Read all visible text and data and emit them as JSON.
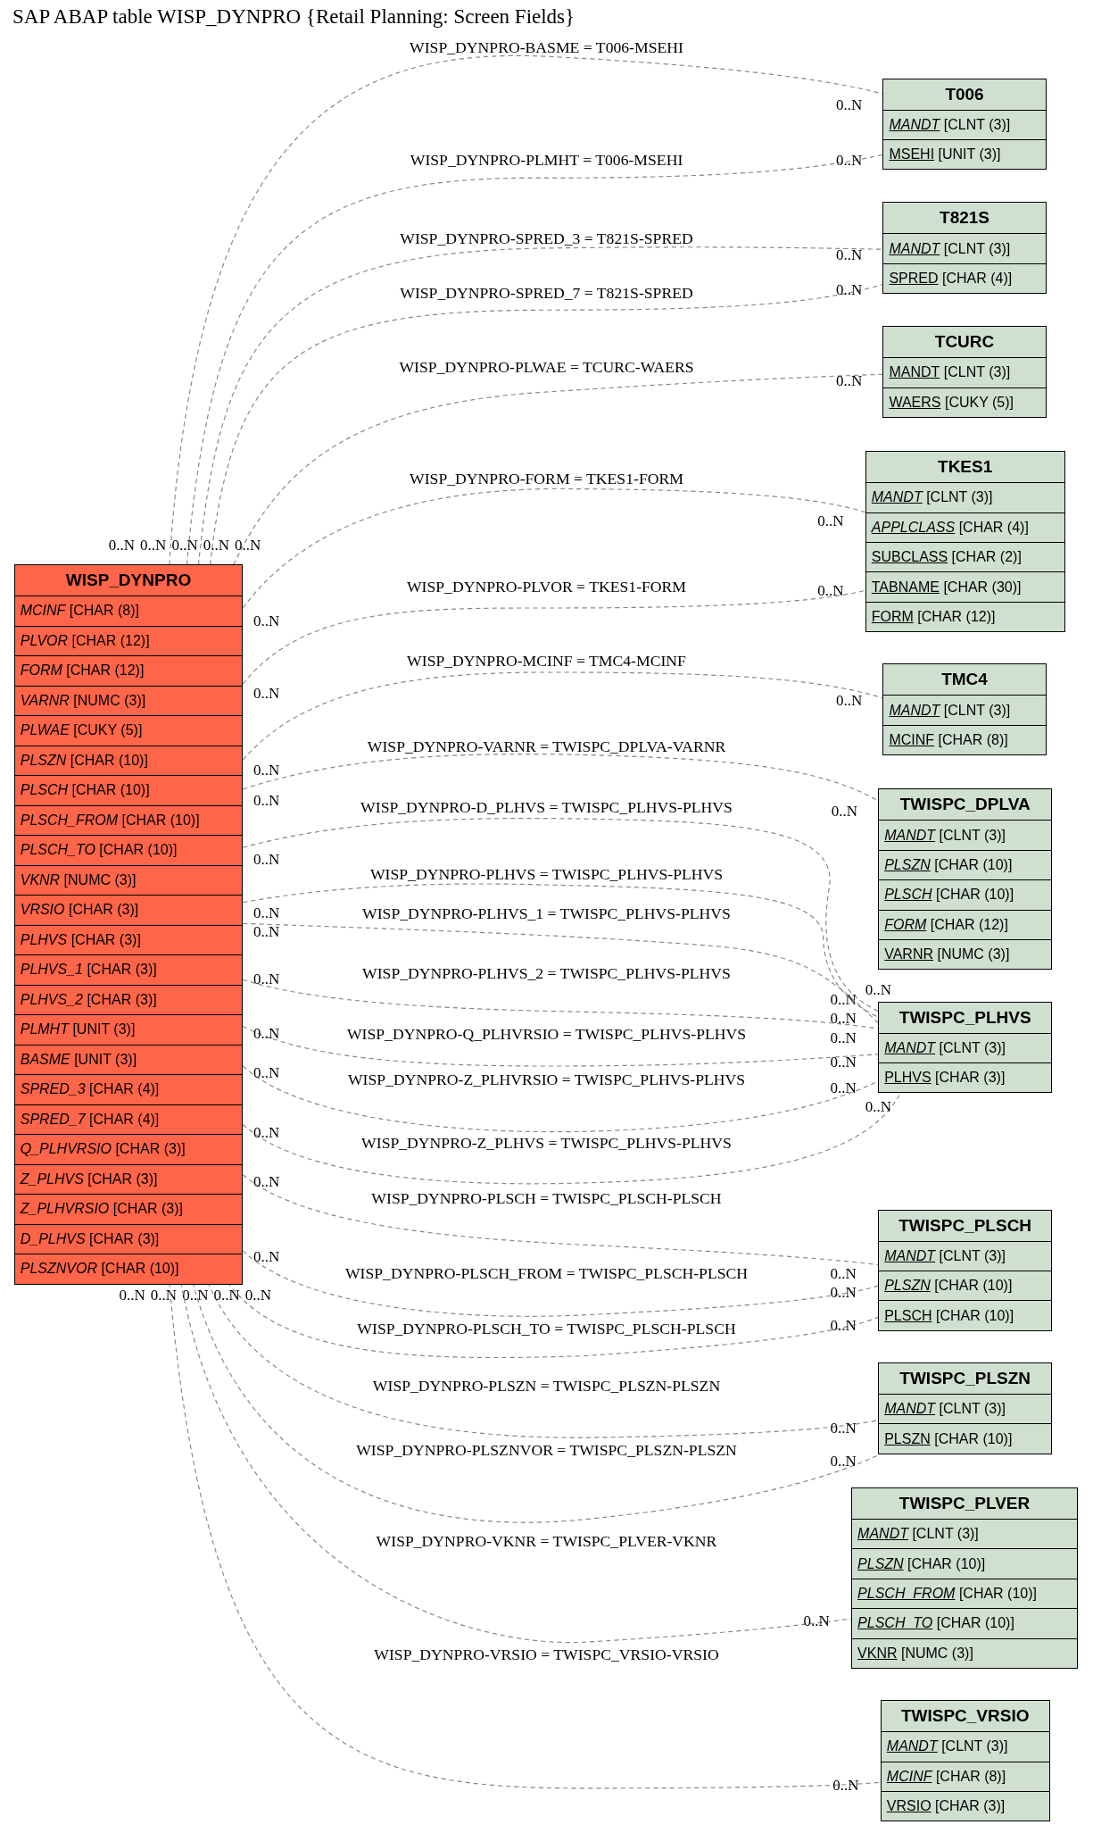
{
  "title": "SAP ABAP table WISP_DYNPRO {Retail Planning: Screen Fields}",
  "tables": [
    {
      "name": "WISP_DYNPRO",
      "kind": "main",
      "fields": [
        {
          "name": "MCINF",
          "type": "[CHAR (8)]",
          "primary_key": false,
          "foreign_key": true
        },
        {
          "name": "PLVOR",
          "type": "[CHAR (12)]",
          "primary_key": false,
          "foreign_key": true
        },
        {
          "name": "FORM",
          "type": "[CHAR (12)]",
          "primary_key": false,
          "foreign_key": true
        },
        {
          "name": "VARNR",
          "type": "[NUMC (3)]",
          "primary_key": false,
          "foreign_key": true
        },
        {
          "name": "PLWAE",
          "type": "[CUKY (5)]",
          "primary_key": false,
          "foreign_key": true
        },
        {
          "name": "PLSZN",
          "type": "[CHAR (10)]",
          "primary_key": false,
          "foreign_key": true
        },
        {
          "name": "PLSCH",
          "type": "[CHAR (10)]",
          "primary_key": false,
          "foreign_key": true
        },
        {
          "name": "PLSCH_FROM",
          "type": "[CHAR (10)]",
          "primary_key": false,
          "foreign_key": true
        },
        {
          "name": "PLSCH_TO",
          "type": "[CHAR (10)]",
          "primary_key": false,
          "foreign_key": true
        },
        {
          "name": "VKNR",
          "type": "[NUMC (3)]",
          "primary_key": false,
          "foreign_key": true
        },
        {
          "name": "VRSIO",
          "type": "[CHAR (3)]",
          "primary_key": false,
          "foreign_key": true
        },
        {
          "name": "PLHVS",
          "type": "[CHAR (3)]",
          "primary_key": false,
          "foreign_key": true
        },
        {
          "name": "PLHVS_1",
          "type": "[CHAR (3)]",
          "primary_key": false,
          "foreign_key": true
        },
        {
          "name": "PLHVS_2",
          "type": "[CHAR (3)]",
          "primary_key": false,
          "foreign_key": true
        },
        {
          "name": "PLMHT",
          "type": "[UNIT (3)]",
          "primary_key": false,
          "foreign_key": true
        },
        {
          "name": "BASME",
          "type": "[UNIT (3)]",
          "primary_key": false,
          "foreign_key": true
        },
        {
          "name": "SPRED_3",
          "type": "[CHAR (4)]",
          "primary_key": false,
          "foreign_key": true
        },
        {
          "name": "SPRED_7",
          "type": "[CHAR (4)]",
          "primary_key": false,
          "foreign_key": true
        },
        {
          "name": "Q_PLHVRSIO",
          "type": "[CHAR (3)]",
          "primary_key": false,
          "foreign_key": true
        },
        {
          "name": "Z_PLHVS",
          "type": "[CHAR (3)]",
          "primary_key": false,
          "foreign_key": true
        },
        {
          "name": "Z_PLHVRSIO",
          "type": "[CHAR (3)]",
          "primary_key": false,
          "foreign_key": true
        },
        {
          "name": "D_PLHVS",
          "type": "[CHAR (3)]",
          "primary_key": false,
          "foreign_key": true
        },
        {
          "name": "PLSZNVOR",
          "type": "[CHAR (10)]",
          "primary_key": false,
          "foreign_key": true
        }
      ]
    },
    {
      "name": "T006",
      "kind": "related",
      "fields": [
        {
          "name": "MANDT",
          "type": "[CLNT (3)]",
          "primary_key": true,
          "foreign_key": true
        },
        {
          "name": "MSEHI",
          "type": "[UNIT (3)]",
          "primary_key": true,
          "foreign_key": false
        }
      ]
    },
    {
      "name": "T821S",
      "kind": "related",
      "fields": [
        {
          "name": "MANDT",
          "type": "[CLNT (3)]",
          "primary_key": true,
          "foreign_key": true
        },
        {
          "name": "SPRED",
          "type": "[CHAR (4)]",
          "primary_key": true,
          "foreign_key": false
        }
      ]
    },
    {
      "name": "TCURC",
      "kind": "related",
      "fields": [
        {
          "name": "MANDT",
          "type": "[CLNT (3)]",
          "primary_key": true,
          "foreign_key": false
        },
        {
          "name": "WAERS",
          "type": "[CUKY (5)]",
          "primary_key": true,
          "foreign_key": false
        }
      ]
    },
    {
      "name": "TKES1",
      "kind": "related",
      "fields": [
        {
          "name": "MANDT",
          "type": "[CLNT (3)]",
          "primary_key": true,
          "foreign_key": true
        },
        {
          "name": "APPLCLASS",
          "type": "[CHAR (4)]",
          "primary_key": true,
          "foreign_key": true
        },
        {
          "name": "SUBCLASS",
          "type": "[CHAR (2)]",
          "primary_key": true,
          "foreign_key": false
        },
        {
          "name": "TABNAME",
          "type": "[CHAR (30)]",
          "primary_key": true,
          "foreign_key": false
        },
        {
          "name": "FORM",
          "type": "[CHAR (12)]",
          "primary_key": true,
          "foreign_key": false
        }
      ]
    },
    {
      "name": "TMC4",
      "kind": "related",
      "fields": [
        {
          "name": "MANDT",
          "type": "[CLNT (3)]",
          "primary_key": true,
          "foreign_key": true
        },
        {
          "name": "MCINF",
          "type": "[CHAR (8)]",
          "primary_key": true,
          "foreign_key": false
        }
      ]
    },
    {
      "name": "TWISPC_DPLVA",
      "kind": "related",
      "fields": [
        {
          "name": "MANDT",
          "type": "[CLNT (3)]",
          "primary_key": true,
          "foreign_key": true
        },
        {
          "name": "PLSZN",
          "type": "[CHAR (10)]",
          "primary_key": true,
          "foreign_key": true
        },
        {
          "name": "PLSCH",
          "type": "[CHAR (10)]",
          "primary_key": true,
          "foreign_key": true
        },
        {
          "name": "FORM",
          "type": "[CHAR (12)]",
          "primary_key": true,
          "foreign_key": true
        },
        {
          "name": "VARNR",
          "type": "[NUMC (3)]",
          "primary_key": true,
          "foreign_key": false
        }
      ]
    },
    {
      "name": "TWISPC_PLHVS",
      "kind": "related",
      "fields": [
        {
          "name": "MANDT",
          "type": "[CLNT (3)]",
          "primary_key": true,
          "foreign_key": true
        },
        {
          "name": "PLHVS",
          "type": "[CHAR (3)]",
          "primary_key": true,
          "foreign_key": false
        }
      ]
    },
    {
      "name": "TWISPC_PLSCH",
      "kind": "related",
      "fields": [
        {
          "name": "MANDT",
          "type": "[CLNT (3)]",
          "primary_key": true,
          "foreign_key": true
        },
        {
          "name": "PLSZN",
          "type": "[CHAR (10)]",
          "primary_key": true,
          "foreign_key": true
        },
        {
          "name": "PLSCH",
          "type": "[CHAR (10)]",
          "primary_key": true,
          "foreign_key": false
        }
      ]
    },
    {
      "name": "TWISPC_PLSZN",
      "kind": "related",
      "fields": [
        {
          "name": "MANDT",
          "type": "[CLNT (3)]",
          "primary_key": true,
          "foreign_key": true
        },
        {
          "name": "PLSZN",
          "type": "[CHAR (10)]",
          "primary_key": true,
          "foreign_key": false
        }
      ]
    },
    {
      "name": "TWISPC_PLVER",
      "kind": "related",
      "fields": [
        {
          "name": "MANDT",
          "type": "[CLNT (3)]",
          "primary_key": true,
          "foreign_key": true
        },
        {
          "name": "PLSZN",
          "type": "[CHAR (10)]",
          "primary_key": true,
          "foreign_key": true
        },
        {
          "name": "PLSCH_FROM",
          "type": "[CHAR (10)]",
          "primary_key": true,
          "foreign_key": true
        },
        {
          "name": "PLSCH_TO",
          "type": "[CHAR (10)]",
          "primary_key": true,
          "foreign_key": true
        },
        {
          "name": "VKNR",
          "type": "[NUMC (3)]",
          "primary_key": true,
          "foreign_key": false
        }
      ]
    },
    {
      "name": "TWISPC_VRSIO",
      "kind": "related",
      "fields": [
        {
          "name": "MANDT",
          "type": "[CLNT (3)]",
          "primary_key": true,
          "foreign_key": true
        },
        {
          "name": "MCINF",
          "type": "[CHAR (8)]",
          "primary_key": true,
          "foreign_key": true
        },
        {
          "name": "VRSIO",
          "type": "[CHAR (3)]",
          "primary_key": true,
          "foreign_key": false
        }
      ]
    }
  ],
  "relations": [
    {
      "label": "WISP_DYNPRO-BASME = T006-MSEHI",
      "source_cardinality": "0..N",
      "target_cardinality": "0..N"
    },
    {
      "label": "WISP_DYNPRO-PLMHT = T006-MSEHI",
      "source_cardinality": "0..N",
      "target_cardinality": "0..N"
    },
    {
      "label": "WISP_DYNPRO-SPRED_3 = T821S-SPRED",
      "source_cardinality": "0..N",
      "target_cardinality": "0..N"
    },
    {
      "label": "WISP_DYNPRO-SPRED_7 = T821S-SPRED",
      "source_cardinality": "0..N",
      "target_cardinality": "0..N"
    },
    {
      "label": "WISP_DYNPRO-PLWAE = TCURC-WAERS",
      "source_cardinality": "0..N",
      "target_cardinality": "0..N"
    },
    {
      "label": "WISP_DYNPRO-FORM = TKES1-FORM",
      "source_cardinality": "0..N",
      "target_cardinality": "0..N"
    },
    {
      "label": "WISP_DYNPRO-PLVOR = TKES1-FORM",
      "source_cardinality": "0..N",
      "target_cardinality": "0..N"
    },
    {
      "label": "WISP_DYNPRO-MCINF = TMC4-MCINF",
      "source_cardinality": "0..N",
      "target_cardinality": "0..N"
    },
    {
      "label": "WISP_DYNPRO-VARNR = TWISPC_DPLVA-VARNR",
      "source_cardinality": "0..N",
      "target_cardinality": "0..N"
    },
    {
      "label": "WISP_DYNPRO-D_PLHVS = TWISPC_PLHVS-PLHVS",
      "source_cardinality": "0..N",
      "target_cardinality": "0..N"
    },
    {
      "label": "WISP_DYNPRO-PLHVS = TWISPC_PLHVS-PLHVS",
      "source_cardinality": "0..N",
      "target_cardinality": "0..N"
    },
    {
      "label": "WISP_DYNPRO-PLHVS_1 = TWISPC_PLHVS-PLHVS",
      "source_cardinality": "0..N",
      "target_cardinality": "0..N"
    },
    {
      "label": "WISP_DYNPRO-PLHVS_2 = TWISPC_PLHVS-PLHVS",
      "source_cardinality": "0..N",
      "target_cardinality": "0..N"
    },
    {
      "label": "WISP_DYNPRO-Q_PLHVRSIO = TWISPC_PLHVS-PLHVS",
      "source_cardinality": "0..N",
      "target_cardinality": "0..N"
    },
    {
      "label": "WISP_DYNPRO-Z_PLHVRSIO = TWISPC_PLHVS-PLHVS",
      "source_cardinality": "0..N",
      "target_cardinality": "0..N"
    },
    {
      "label": "WISP_DYNPRO-Z_PLHVS = TWISPC_PLHVS-PLHVS",
      "source_cardinality": "0..N",
      "target_cardinality": "0..N"
    },
    {
      "label": "WISP_DYNPRO-PLSCH = TWISPC_PLSCH-PLSCH",
      "source_cardinality": "0..N",
      "target_cardinality": "0..N"
    },
    {
      "label": "WISP_DYNPRO-PLSCH_FROM = TWISPC_PLSCH-PLSCH",
      "source_cardinality": "0..N",
      "target_cardinality": "0..N"
    },
    {
      "label": "WISP_DYNPRO-PLSCH_TO = TWISPC_PLSCH-PLSCH",
      "source_cardinality": "0..N",
      "target_cardinality": "0..N"
    },
    {
      "label": "WISP_DYNPRO-PLSZN = TWISPC_PLSZN-PLSZN",
      "source_cardinality": "0..N",
      "target_cardinality": "0..N"
    },
    {
      "label": "WISP_DYNPRO-PLSZNVOR = TWISPC_PLSZN-PLSZN",
      "source_cardinality": "0..N",
      "target_cardinality": "0..N"
    },
    {
      "label": "WISP_DYNPRO-VKNR = TWISPC_PLVER-VKNR",
      "source_cardinality": "0..N",
      "target_cardinality": "0..N"
    },
    {
      "label": "WISP_DYNPRO-VRSIO = TWISPC_VRSIO-VRSIO",
      "source_cardinality": "0..N",
      "target_cardinality": "0..N"
    }
  ]
}
